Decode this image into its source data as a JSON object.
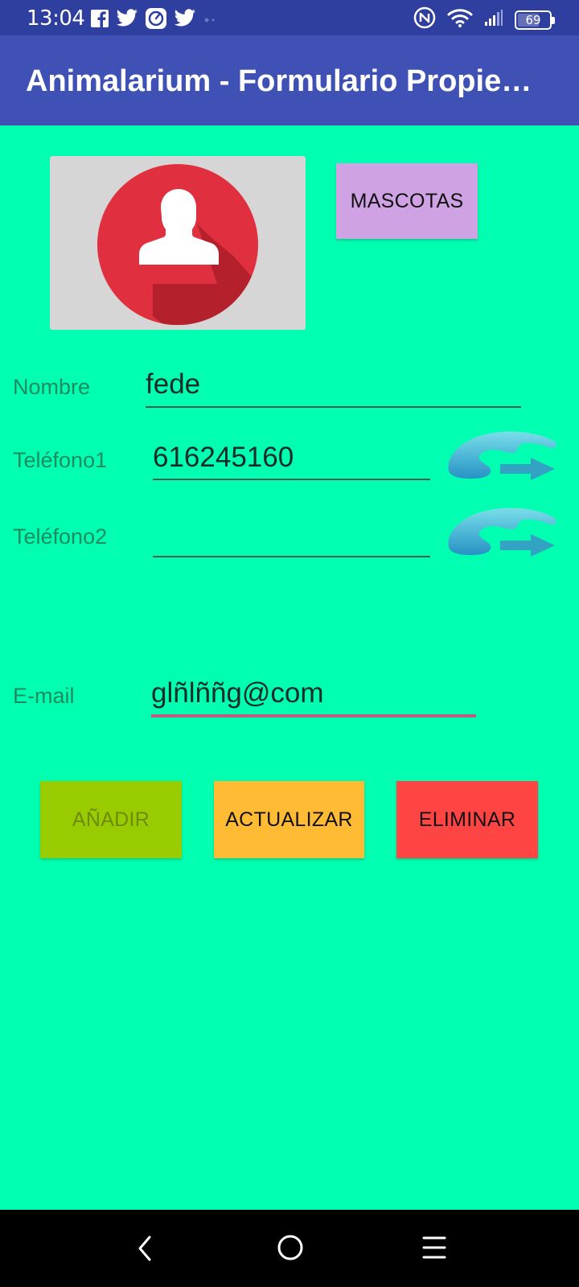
{
  "status_bar": {
    "time": "13:04",
    "battery": "69",
    "notification_icons": [
      "facebook-icon",
      "twitter-icon",
      "speedometer-icon",
      "twitter-icon",
      "dots-icon"
    ],
    "system_icons": [
      "nfc-icon",
      "wifi-icon",
      "signal-icon",
      "battery-icon"
    ]
  },
  "app_bar": {
    "title": "Animalarium - Formulario Propietario"
  },
  "form": {
    "mascotas_label": "MASCOTAS",
    "nombre": {
      "label": "Nombre",
      "value": "fede"
    },
    "telefono1": {
      "label": "Teléfono1",
      "value": "616245160"
    },
    "telefono2": {
      "label": "Teléfono2",
      "value": ""
    },
    "email": {
      "label": "E-mail",
      "value": "glñlññg@com"
    }
  },
  "actions": {
    "add_label": "AÑADIR",
    "update_label": "ACTUALIZAR",
    "delete_label": "ELIMINAR"
  },
  "colors": {
    "background": "#00FFB0",
    "app_bar": "#3F51B5",
    "status_bar": "#2F3F9F",
    "mascotas": "#CFA2E4",
    "add": "#99CC00",
    "update": "#FFBB33",
    "delete": "#FF4444"
  }
}
